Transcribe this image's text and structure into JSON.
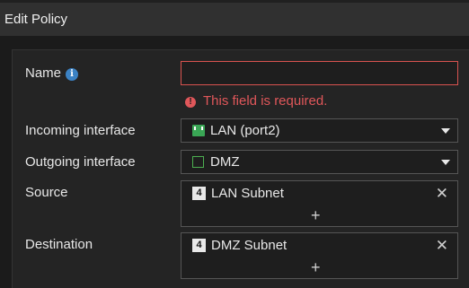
{
  "dialog": {
    "title": "Edit Policy"
  },
  "form": {
    "name": {
      "label": "Name",
      "info_icon": "info-icon",
      "value": "",
      "error": "This field is required."
    },
    "incoming_interface": {
      "label": "Incoming interface",
      "value": "LAN (port2)",
      "icon": "port-icon"
    },
    "outgoing_interface": {
      "label": "Outgoing interface",
      "value": "DMZ",
      "icon": "zone-icon"
    },
    "source": {
      "label": "Source",
      "entries": [
        {
          "label": "LAN Subnet",
          "icon": "address-icon"
        }
      ],
      "add": "+"
    },
    "destination": {
      "label": "Destination",
      "entries": [
        {
          "label": "DMZ Subnet",
          "icon": "address-icon"
        }
      ],
      "add": "+"
    }
  },
  "colors": {
    "error": "#e0575a",
    "info": "#3b82c4",
    "port_icon": "#3aa655"
  }
}
